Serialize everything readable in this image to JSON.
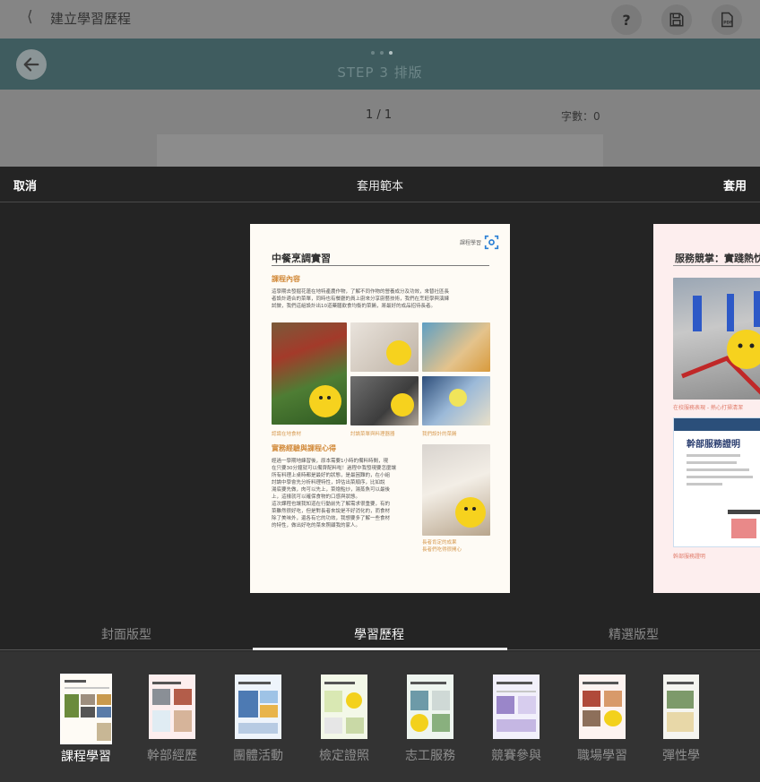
{
  "topbar": {
    "title": "建立學習歷程",
    "help_label": "?"
  },
  "stepbar": {
    "step_label": "STEP 3 排版"
  },
  "infobar": {
    "pager": "1 / 1",
    "word_count": "字數：0"
  },
  "modal": {
    "cancel_label": "取消",
    "title": "套用範本",
    "apply_label": "套用"
  },
  "preview": {
    "tag": "課程學習",
    "title": "中餐烹調實習",
    "section1_heading": "課程內容",
    "section1_text": [
      "這學期去發掘花蓮在地特產農作物，了解不同作物的營養成分及功效，來替社區長",
      "者設計適合的菜單，同時也有餐廳的員上廚來分享廚藝技術，我們在烹飪學與演練",
      "試做，我們這組設計出10道藥膳飲食均衡的菜餚，將最好的成品招待長者。"
    ],
    "captions": [
      "認識在地食材",
      "討論菜單與料理器器",
      "我們設計的菜餚"
    ],
    "section2_heading": "實務經驗與課程心得",
    "section2_text": [
      "經過一學期地練習後，原本需要1小時的備料時間，現",
      "在只要30分鐘就可以備齊配料啦！過程中我發現要怎麼讓",
      "所有料理上桌時都是最好的狀態，是最困難的，在小組",
      "討論中學會先分析料理特性，評估出菜順序，比如說",
      "湯底要先做，肉可以先上，菜燴點炒，湯蒸魚可以最後",
      "上，這樣就可以確保食物的口感與狀態。",
      "這次課程也讓我知道在行動前先了解需求很重要，有的",
      "菜雖然很好吃，但是對長者來說是不好消化的，而食材",
      "除了美味外，還各有它的功效，我想要多了解一些食材",
      "的特性，做出好吃的菜來照顧我的家人。"
    ],
    "caption4": [
      "長者肯定的成果",
      "長者們吃得很開心"
    ]
  },
  "preview2": {
    "title": "服務競掌：實踐熱忱",
    "caption1": "在校服務表現 - 熱心打掃清潔",
    "cert_title": "幹部服務證明",
    "caption2": "幹部服務證明"
  },
  "tabs": [
    {
      "label": "封面版型"
    },
    {
      "label": "學習歷程"
    },
    {
      "label": "精選版型"
    }
  ],
  "templates": [
    {
      "label": "課程學習"
    },
    {
      "label": "幹部經歷"
    },
    {
      "label": "團體活動"
    },
    {
      "label": "檢定證照"
    },
    {
      "label": "志工服務"
    },
    {
      "label": "競賽參與"
    },
    {
      "label": "職場學習"
    },
    {
      "label": "彈性學"
    }
  ],
  "colors": {
    "accent": "#d28a3a",
    "teal": "#3f5c5f",
    "modal_bg": "#242424"
  }
}
